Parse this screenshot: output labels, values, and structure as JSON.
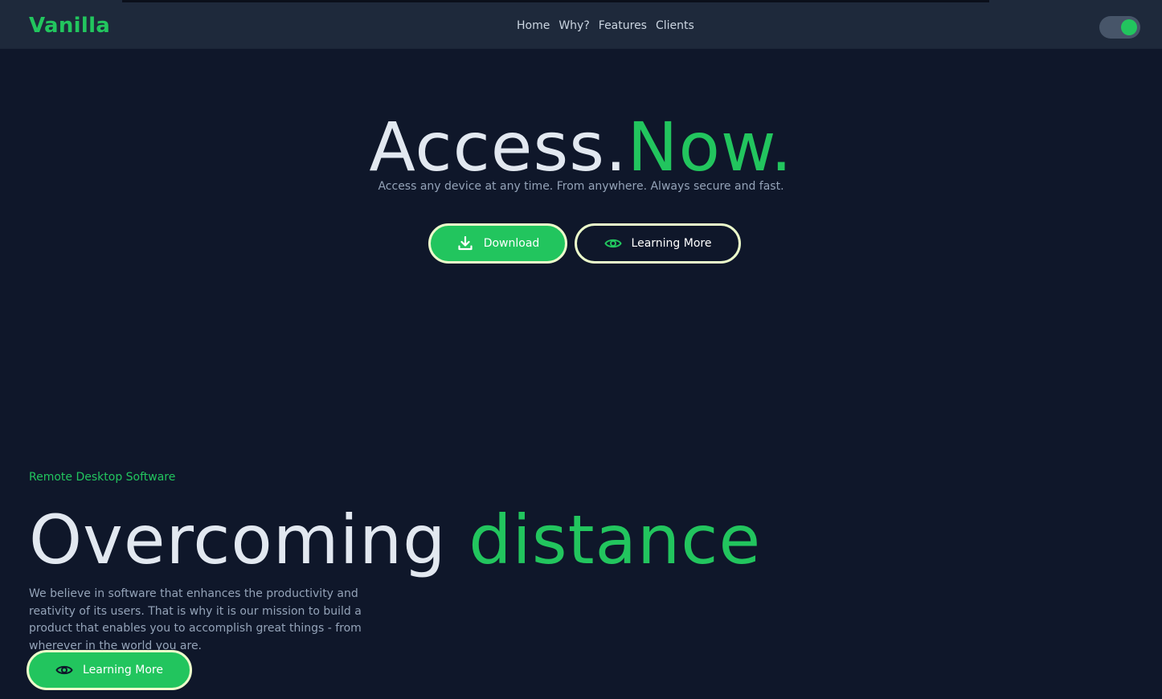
{
  "brand": {
    "name": "Vanilla"
  },
  "nav": {
    "items": [
      "Home",
      "Why?",
      "Features",
      "Clients"
    ]
  },
  "theme_toggle": {
    "state": "on"
  },
  "hero": {
    "title_main": "Access.",
    "title_accent": "Now.",
    "subtitle": "Access any device at any time. From anywhere. Always secure and fast.",
    "download_label": "Download",
    "learn_label": "Learning More"
  },
  "section": {
    "eyebrow": "Remote Desktop Software",
    "title_main": "Overcoming ",
    "title_accent": "distance",
    "text": "We believe in software that enhances the productivity and reativity of its users. That is why it is our mission to build a product that enables you to accomplish great things - from wherever in the world you are.",
    "learn_label": "Learning More"
  },
  "colors": {
    "accent": "#22c55e",
    "background": "#0f172a",
    "nav_background": "#1e293b",
    "button_border": "#ecfccb"
  },
  "icons": {
    "download": "download-icon",
    "eye": "eye-icon"
  }
}
